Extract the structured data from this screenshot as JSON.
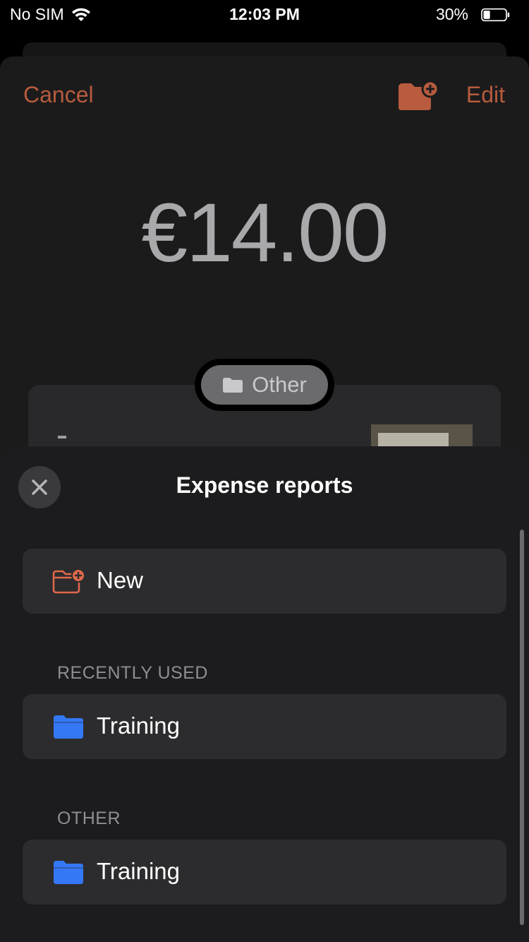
{
  "status_bar": {
    "carrier": "No SIM",
    "time": "12:03 PM",
    "battery_percent": "30%",
    "battery_level": 0.3
  },
  "nav": {
    "cancel_label": "Cancel",
    "edit_label": "Edit",
    "add_folder_icon": "folder-add-icon"
  },
  "expense": {
    "amount": "€14.00",
    "category": "Other",
    "line_item_text": "-"
  },
  "sheet": {
    "title": "Expense reports",
    "new_label": "New",
    "sections": [
      {
        "header": "RECENTLY USED",
        "items": [
          {
            "label": "Training"
          }
        ]
      },
      {
        "header": "OTHER",
        "items": [
          {
            "label": "Training"
          }
        ]
      }
    ]
  },
  "colors": {
    "accent": "#b85b3e",
    "new_icon": "#e0694a",
    "folder_blue": "#3478f6",
    "sheet_bg": "#1c1c1e",
    "row_bg": "#2c2c2e"
  }
}
